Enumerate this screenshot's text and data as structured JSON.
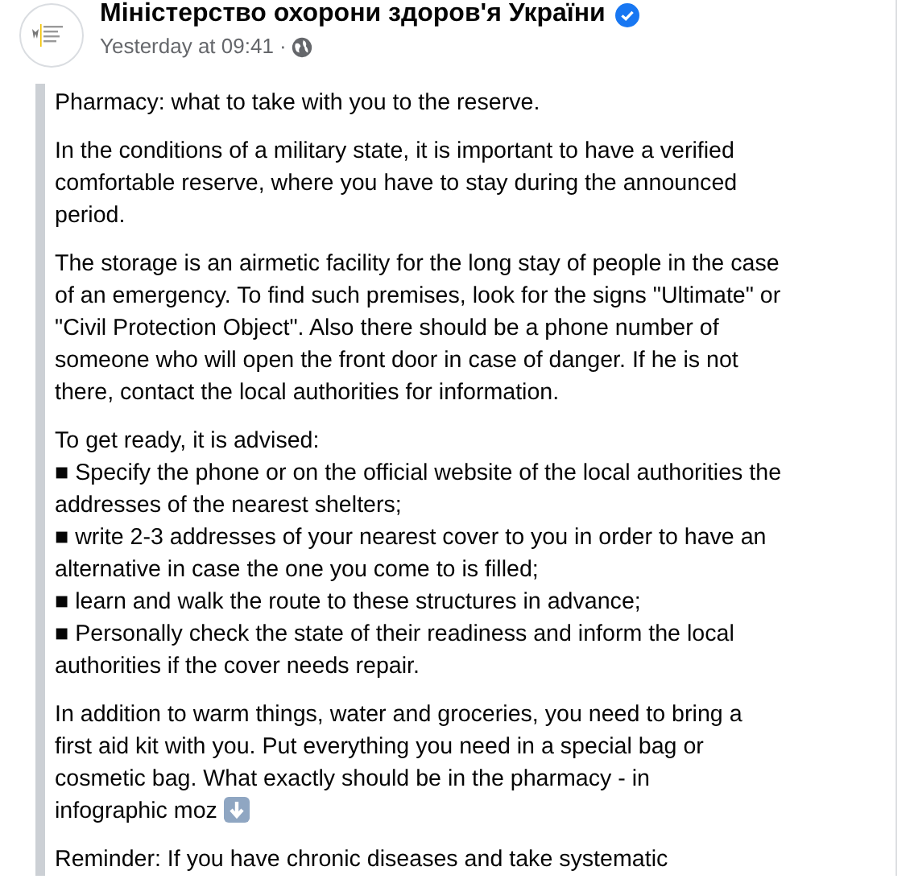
{
  "post": {
    "author": "Міністерство охорони здоров'я України",
    "verified": true,
    "time": "Yesterday at 09:41 ·",
    "paragraphs": [
      {
        "kind": "text",
        "text": "Pharmacy: what to take with you to the reserve."
      },
      {
        "kind": "text",
        "text": "In the conditions of a military state, it is important to have a verified comfortable reserve, where you have to stay during the announced period."
      },
      {
        "kind": "text",
        "text": "The storage is an airmetic facility for the long stay of people in the case of an emergency. To find such premises, look for the signs \"Ultimate\" or \"Civil Protection Object\". Also there should be a phone number of someone who will open the front door in case of danger. If he is not there, contact the local authorities for information."
      },
      {
        "kind": "lines",
        "lines": [
          "To get ready, it is advised:",
          "■ Specify the phone or on the official website of the local authorities the addresses of the nearest shelters;",
          "■ write 2-3 addresses of your nearest cover to you in order to have an alternative in case the one you come to is filled;",
          "■ learn and walk the route to these structures in advance;",
          "■ Personally check the state of their readiness and inform the local authorities if the cover needs repair."
        ]
      },
      {
        "kind": "text_arrow",
        "text": "In addition to warm things, water and groceries, you need to bring a first aid kit with you. Put everything you need in a special bag or cosmetic bag. What exactly should be in the pharmacy - in",
        "last_line": "infographic moz"
      },
      {
        "kind": "text",
        "text": "Reminder: If you have chronic diseases and take systematic"
      }
    ]
  }
}
